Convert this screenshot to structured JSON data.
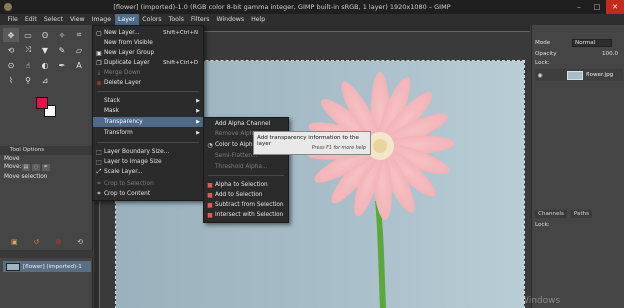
{
  "window": {
    "title": "[flower] (imported)-1.0 (RGB color 8-bit gamma integer, GIMP built-in sRGB, 1 layer) 1920x1080 – GIMP"
  },
  "menubar": [
    "File",
    "Edit",
    "Select",
    "View",
    "Image",
    "Layer",
    "Colors",
    "Tools",
    "Filters",
    "Windows",
    "Help"
  ],
  "layer_menu": {
    "items": [
      {
        "label": "New Layer...",
        "shortcut": "Shift+Ctrl+N"
      },
      {
        "label": "New from Visible",
        "shortcut": ""
      },
      {
        "label": "New Layer Group",
        "shortcut": ""
      },
      {
        "label": "Duplicate Layer",
        "shortcut": "Shift+Ctrl+D"
      },
      {
        "label": "Merge Down",
        "shortcut": ""
      },
      {
        "label": "Delete Layer",
        "shortcut": ""
      },
      {
        "label": "Stack"
      },
      {
        "label": "Mask"
      },
      {
        "label": "Transparency"
      },
      {
        "label": "Transform"
      },
      {
        "label": "Layer Boundary Size..."
      },
      {
        "label": "Layer to Image Size"
      },
      {
        "label": "Scale Layer..."
      },
      {
        "label": "Crop to Selection"
      },
      {
        "label": "Crop to Content"
      }
    ]
  },
  "transparency_menu": {
    "items": [
      "Add Alpha Channel",
      "Remove Alpha...",
      "Color to Alpha...",
      "Semi-Flatten...",
      "Threshold Alpha...",
      "Alpha to Selection",
      "Add to Selection",
      "Subtract from Selection",
      "Intersect with Selection"
    ]
  },
  "tooltip": {
    "text": "Add transparency information to the layer",
    "help": "Press F1 for more help"
  },
  "tool_options": {
    "tab": "Tool Options",
    "title": "Move",
    "move_label": "Move:",
    "status": "Move selection"
  },
  "colors": {
    "foreground": "#e8104a",
    "background": "#ffffff"
  },
  "images_panel": {
    "image_name": "[flower] (imported)-1"
  },
  "layers_panel": {
    "mode_label": "Mode",
    "mode_value": "Normal",
    "opacity_label": "Opacity",
    "opacity_value": "100.0",
    "lock_label": "Lock:",
    "layer_name": "flower.jpg"
  },
  "channels_panel": {
    "tabs": [
      "Channels",
      "Paths"
    ],
    "lock_label": "Lock:"
  },
  "watermark": "Windows"
}
